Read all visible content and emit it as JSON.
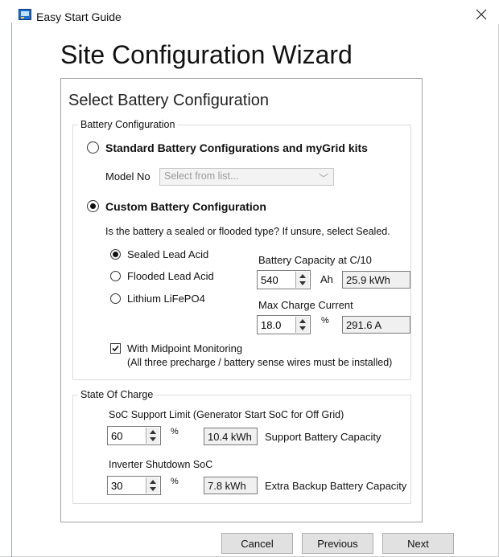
{
  "window": {
    "title": "Easy Start Guide",
    "close_glyph": "✕"
  },
  "wizard": {
    "title": "Site Configuration Wizard"
  },
  "panel": {
    "title": "Select Battery Configuration"
  },
  "battery_group": {
    "legend": "Battery Configuration",
    "standard_option": {
      "label": "Standard Battery Configurations and myGrid kits",
      "selected": false
    },
    "model_no": {
      "label": "Model No",
      "placeholder": "Select from list..."
    },
    "custom_option": {
      "label": "Custom Battery Configuration",
      "selected": true
    },
    "question": "Is the battery a sealed or flooded type? If unsure, select Sealed.",
    "types": [
      {
        "label": "Sealed Lead Acid",
        "selected": true
      },
      {
        "label": "Flooded Lead Acid",
        "selected": false
      },
      {
        "label": "Lithium LiFePO4",
        "selected": false
      }
    ],
    "capacity": {
      "label": "Battery Capacity at C/10",
      "value": "540",
      "unit": "Ah",
      "readout": "25.9 kWh"
    },
    "charge": {
      "label": "Max Charge Current",
      "value": "18.0",
      "unit": "%",
      "readout": "291.6 A"
    },
    "midpoint": {
      "label": "With Midpoint Monitoring",
      "note": "(All three precharge / battery sense wires must be installed)",
      "checked": true
    }
  },
  "soc_group": {
    "legend": "State Of Charge",
    "support": {
      "label": "SoC Support Limit (Generator Start SoC for Off Grid)",
      "value": "60",
      "unit": "%",
      "readout": "10.4 kWh",
      "desc": "Support Battery Capacity"
    },
    "shutdown": {
      "label": "Inverter Shutdown SoC",
      "value": "30",
      "unit": "%",
      "readout": "7.8 kWh",
      "desc": "Extra Backup Battery Capacity"
    }
  },
  "buttons": {
    "cancel": "Cancel",
    "previous": "Previous",
    "next": "Next"
  },
  "colors": {
    "accent": "#1e6fd0",
    "border": "#a0a0a0"
  }
}
